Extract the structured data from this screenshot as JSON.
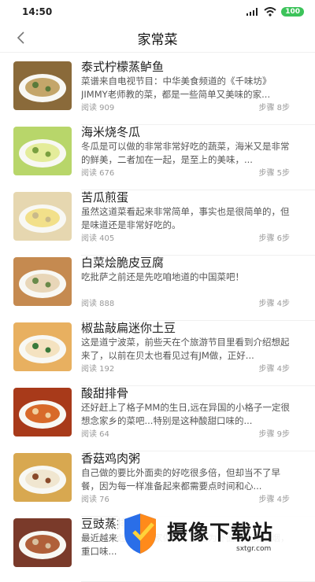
{
  "status": {
    "time": "14:50",
    "battery": "100"
  },
  "header": {
    "title": "家常菜"
  },
  "items": [
    {
      "title": "泰式柠檬蒸鲈鱼",
      "desc": "菜谱来自电视节目：中华美食频道的《千味坊》JIMMY老师教的菜，都是一些简单又美味的家...",
      "reads": "阅读 909",
      "steps": "步骤  8步",
      "thumb": [
        "#8a6a3a",
        "#c4a66a",
        "#5a7a3a"
      ]
    },
    {
      "title": "海米烧冬瓜",
      "desc": "冬瓜是可以做的非常非常好吃的蔬菜，海米又是非常的鲜美，二者加在一起，是至上的美味，...",
      "reads": "阅读 676",
      "steps": "步骤  5步",
      "thumb": [
        "#b8d66a",
        "#e4ec9a",
        "#7aa040"
      ]
    },
    {
      "title": "苦瓜煎蛋",
      "desc": "虽然这道菜看起来非常简单，事实也是很简单的，但是味道还是非常好吃的。",
      "reads": "阅读 405",
      "steps": "步骤  6步",
      "thumb": [
        "#e6d7b0",
        "#f2e08a",
        "#c9b98a"
      ]
    },
    {
      "title": "白菜烩脆皮豆腐",
      "desc": "吃批萨之前还是先吃咱地道的中国菜吧！",
      "reads": "阅读 888",
      "steps": "步骤  4步",
      "thumb": [
        "#c58a50",
        "#e8d6b8",
        "#6a8a4a"
      ]
    },
    {
      "title": "椒盐敲扁迷你土豆",
      "desc": "这是道宁波菜，前些天在个旅游节目里看到介绍想起来了，以前在贝太也看见过有JM做，正好...",
      "reads": "阅读 192",
      "steps": "步骤  4步",
      "thumb": [
        "#e8b060",
        "#f4e2c0",
        "#3a7a3a"
      ]
    },
    {
      "title": "酸甜排骨",
      "desc": "还好赶上了格子MM的生日,远在异国的小格子一定很想念家乡的菜吧...特别是这种酸甜口味的...",
      "reads": "阅读 64",
      "steps": "步骤  9步",
      "thumb": [
        "#a83a1a",
        "#d86a2a",
        "#f0d0a0"
      ]
    },
    {
      "title": "香菇鸡肉粥",
      "desc": "自己做的要比外面卖的好吃很多倍，但却当不了早餐，因为每一样准备起来都需要点时间和心...",
      "reads": "阅读 76",
      "steps": "步骤  4步",
      "thumb": [
        "#d8a850",
        "#f0e6d0",
        "#8a4a2a"
      ]
    },
    {
      "title": "豆豉蒸排骨",
      "desc": "最近越来越喜欢在家做饭了，因为外面的饭菜油烟，重口味...",
      "reads": "",
      "steps": "",
      "thumb": [
        "#7a3a2a",
        "#b0603a",
        "#d8c0a0"
      ]
    }
  ],
  "watermark": {
    "text": "摄像下载站",
    "url": "sxtgr.com"
  }
}
